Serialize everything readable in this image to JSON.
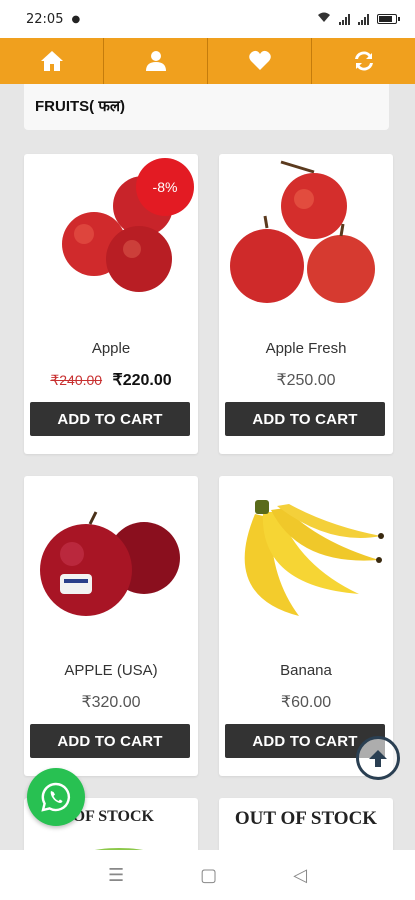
{
  "status_bar": {
    "time": "22:05",
    "dot": "●"
  },
  "nav": {
    "home_icon": "home-icon",
    "profile_icon": "user-icon",
    "wishlist_icon": "heart-icon",
    "refresh_icon": "refresh-icon",
    "accent": "#f0a01e"
  },
  "category": {
    "title": "FRUITS( फल)"
  },
  "products": [
    {
      "name": "Apple",
      "old_price": "₹240.00",
      "price": "₹220.00",
      "discount": "-8%",
      "button": "ADD TO CART"
    },
    {
      "name": "Apple Fresh",
      "price": "₹250.00",
      "button": "ADD TO CART"
    },
    {
      "name": "APPLE (USA)",
      "price": "₹320.00",
      "button": "ADD TO CART"
    },
    {
      "name": "Banana",
      "price": "₹60.00",
      "button": "ADD TO CART"
    }
  ],
  "out_of_stock": [
    {
      "label": "UT OF STOCK"
    },
    {
      "label": "OUT OF STOCK"
    }
  ],
  "system_nav": {
    "menu": "☰",
    "home": "▢",
    "back": "◁"
  }
}
